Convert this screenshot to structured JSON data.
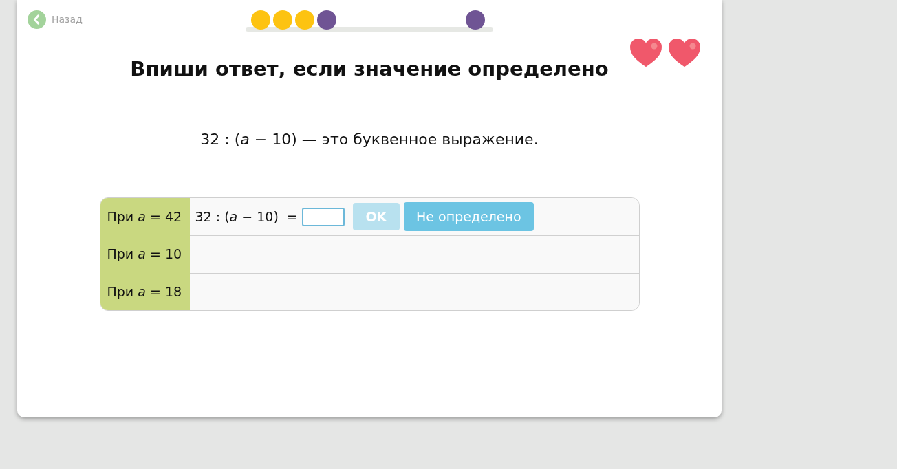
{
  "back_button": {
    "label": "Назад"
  },
  "progress": {
    "steps": [
      {
        "color": "#fdc311"
      },
      {
        "color": "#fdc311"
      },
      {
        "color": "#fdc311"
      },
      {
        "color": "#6f5494"
      }
    ],
    "finish": {
      "color": "#6f5494"
    }
  },
  "lives": [
    {
      "filled": true
    },
    {
      "filled": true
    }
  ],
  "title": "Впиши ответ, если значение определено",
  "statement": "32 : (*a* − 10) — это буквенное выражение.",
  "table": {
    "rows": [
      {
        "label": "При *a* = 42",
        "task": {
          "expression": "32 : (*a* − 10)  =",
          "answer_field": {
            "focused": true
          },
          "ok_button": {
            "label": "OK",
            "disabled": true
          },
          "undefined_button": {
            "label": "Не определено"
          }
        }
      },
      {
        "label": "При *a* = 10"
      },
      {
        "label": "При *a* = 18"
      }
    ]
  }
}
